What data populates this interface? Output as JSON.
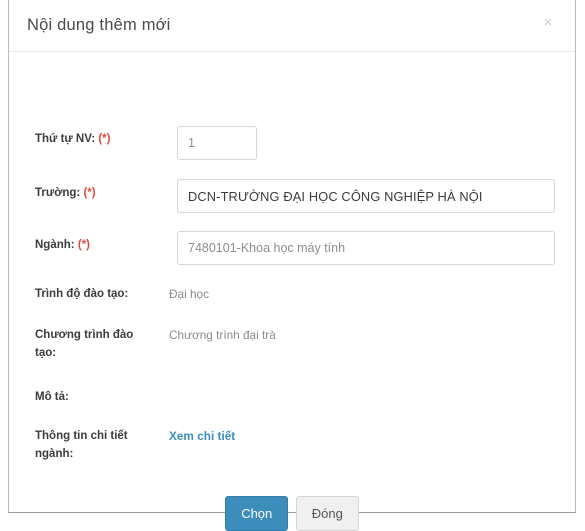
{
  "modal": {
    "title": "Nội dung thêm mới",
    "close_icon": "×"
  },
  "fields": {
    "order": {
      "label": "Thứ tự NV:",
      "required_marker": "(*)",
      "value": "1",
      "placeholder": ""
    },
    "school": {
      "label": "Trường:",
      "required_marker": "(*)",
      "value": "DCN-TRƯỜNG ĐẠI HỌC CÔNG NGHIỆP HÀ NỘI",
      "placeholder": ""
    },
    "major": {
      "label": "Ngành:",
      "required_marker": "(*)",
      "value": "7480101-Khoa học máy tính",
      "placeholder": "7480101-Khoa học máy tính"
    },
    "level": {
      "label": "Trình độ đào tạo:",
      "value": "Đại học"
    },
    "program": {
      "label": "Chương trình đào tạo:",
      "value": "Chương trình đại trà"
    },
    "description": {
      "label": "Mô tả:",
      "value": ""
    },
    "major_detail": {
      "label": "Thông tin chi tiết ngành:",
      "link_text": "Xem chi tiết"
    }
  },
  "footer": {
    "confirm_label": "Chọn",
    "close_label": "Đóng"
  },
  "colors": {
    "primary": "#3c8dbc",
    "required": "#dd4b39",
    "link": "#3c8dbc",
    "default_button_bg": "#f0f0f0"
  }
}
